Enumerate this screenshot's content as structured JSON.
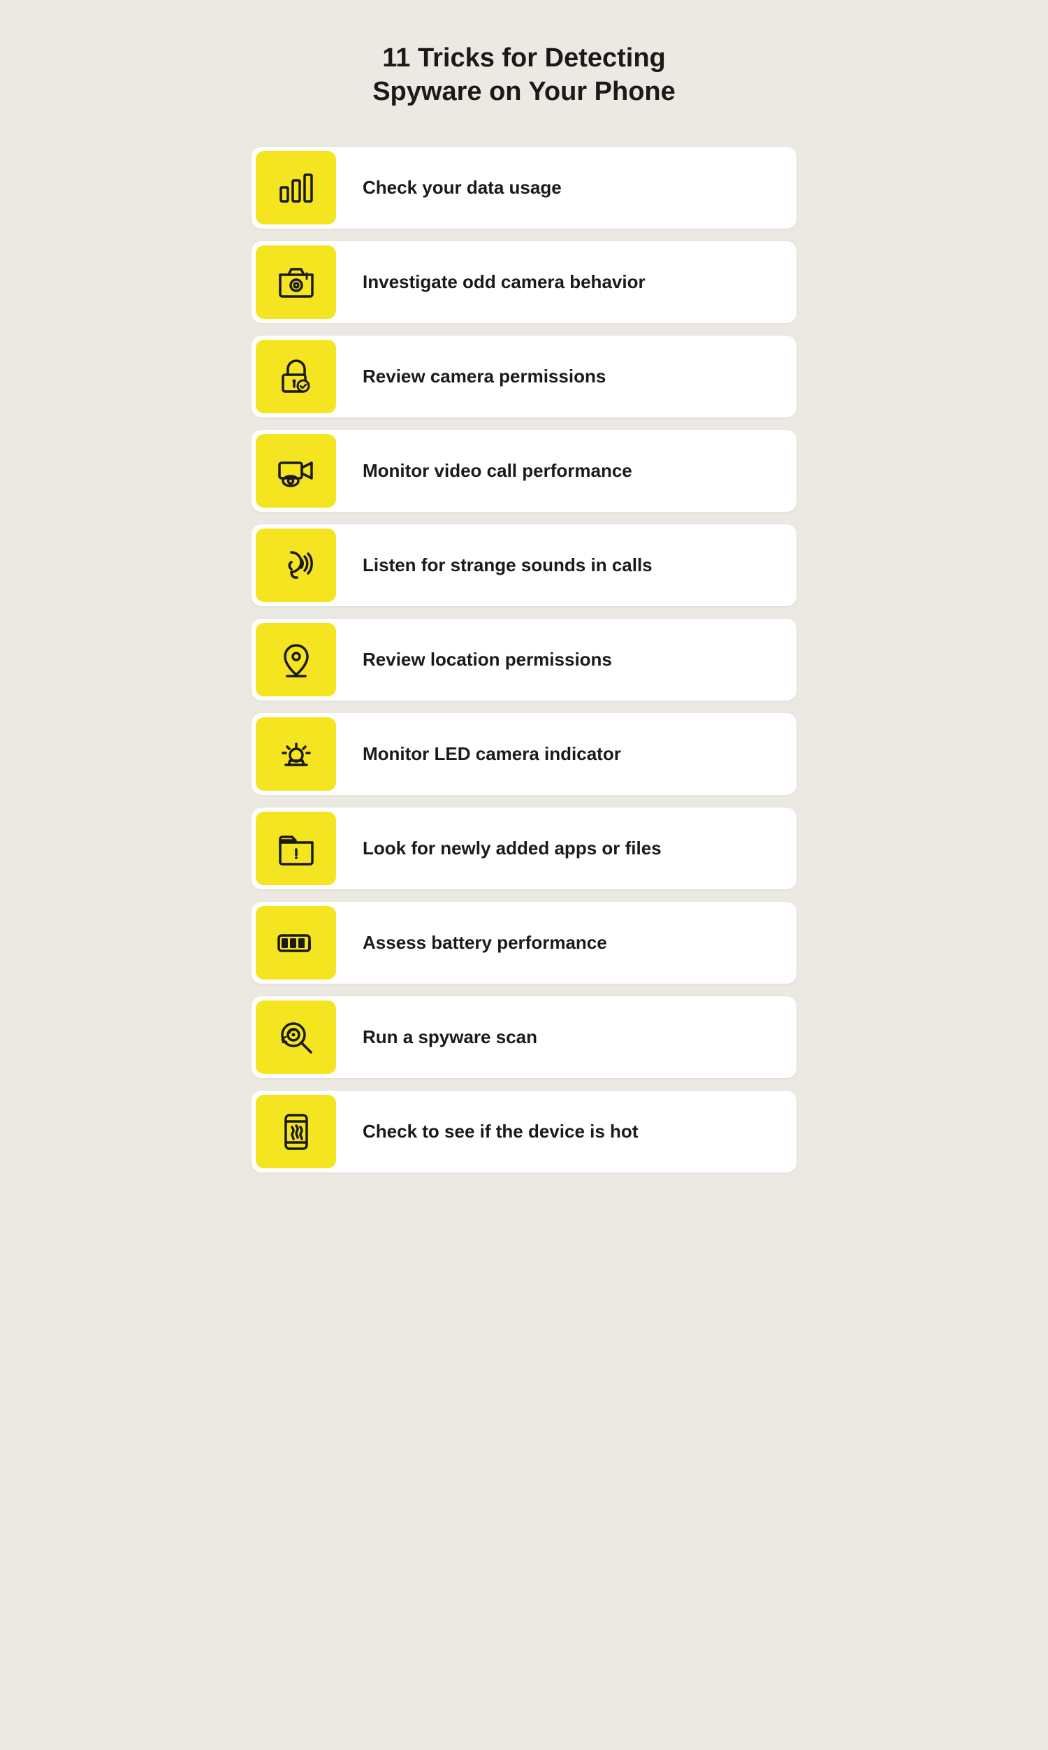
{
  "title": "11 Tricks for Detecting\nSpyware on Your Phone",
  "items": [
    {
      "id": "data-usage",
      "label": "Check your data usage",
      "icon": "bar-chart"
    },
    {
      "id": "camera-behavior",
      "label": "Investigate odd camera behavior",
      "icon": "camera-alert"
    },
    {
      "id": "camera-permissions",
      "label": "Review camera permissions",
      "icon": "lock-check"
    },
    {
      "id": "video-call",
      "label": "Monitor video call performance",
      "icon": "video-eye"
    },
    {
      "id": "strange-sounds",
      "label": "Listen for strange sounds in calls",
      "icon": "ear-sound"
    },
    {
      "id": "location-permissions",
      "label": "Review location permissions",
      "icon": "location-pin"
    },
    {
      "id": "led-indicator",
      "label": "Monitor LED camera indicator",
      "icon": "alarm-light"
    },
    {
      "id": "new-apps",
      "label": "Look for newly added apps or files",
      "icon": "folder-warning"
    },
    {
      "id": "battery",
      "label": "Assess battery performance",
      "icon": "battery"
    },
    {
      "id": "spyware-scan",
      "label": "Run a spyware scan",
      "icon": "spy-search"
    },
    {
      "id": "device-hot",
      "label": "Check to see if the device is hot",
      "icon": "phone-hot"
    }
  ]
}
